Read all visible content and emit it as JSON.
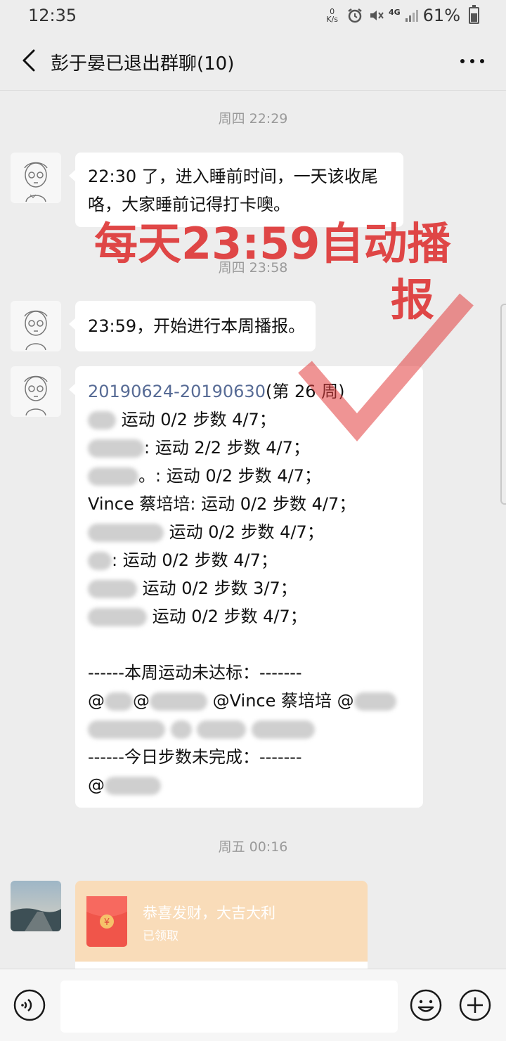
{
  "status_bar": {
    "time": "12:35",
    "net_speed": "0",
    "net_unit": "K/s",
    "network": "4G",
    "battery": "61%"
  },
  "header": {
    "title": "彭于晏已退出群聊(10)",
    "back_icon": "chevron-left-icon",
    "more_icon": "more-horizontal-icon"
  },
  "overlay": {
    "line1": "每天23:59自动播",
    "line2": "报",
    "color": "#dc2828"
  },
  "messages": {
    "ts1": "周四 22:29",
    "msg1_line1": "22:30 了，进入睡前时间，一天该收尾",
    "msg1_line2": "咯，大家睡前记得打卡噢。",
    "ts2": "周四 23:58",
    "msg2": "23:59，开始进行本周播报。",
    "report": {
      "date_range": "20190624-20190630",
      "week": "(第 26 周)",
      "rows": [
        "运动 0/2 步数 4/7；",
        ": 运动 2/2 步数 4/7；",
        "。: 运动 0/2 步数 4/7；",
        "Vince 蔡培培: 运动 0/2 步数 4/7；",
        "运动 0/2 步数 4/7；",
        ": 运动 0/2 步数 4/7；",
        "运动 0/2 步数 3/7；",
        "运动 0/2 步数 4/7；"
      ],
      "sport_header": "------本周运动未达标：-------",
      "sport_mention": "@Vince 蔡培培 @",
      "steps_header": "------今日步数未完成：-------"
    },
    "ts3": "周五 00:16",
    "red_packet": {
      "title": "恭喜发财，大吉大利",
      "status": "已领取",
      "symbol": "¥"
    }
  },
  "input_bar": {
    "voice_icon": "voice-icon",
    "emoji_icon": "emoji-icon",
    "plus_icon": "plus-icon"
  }
}
